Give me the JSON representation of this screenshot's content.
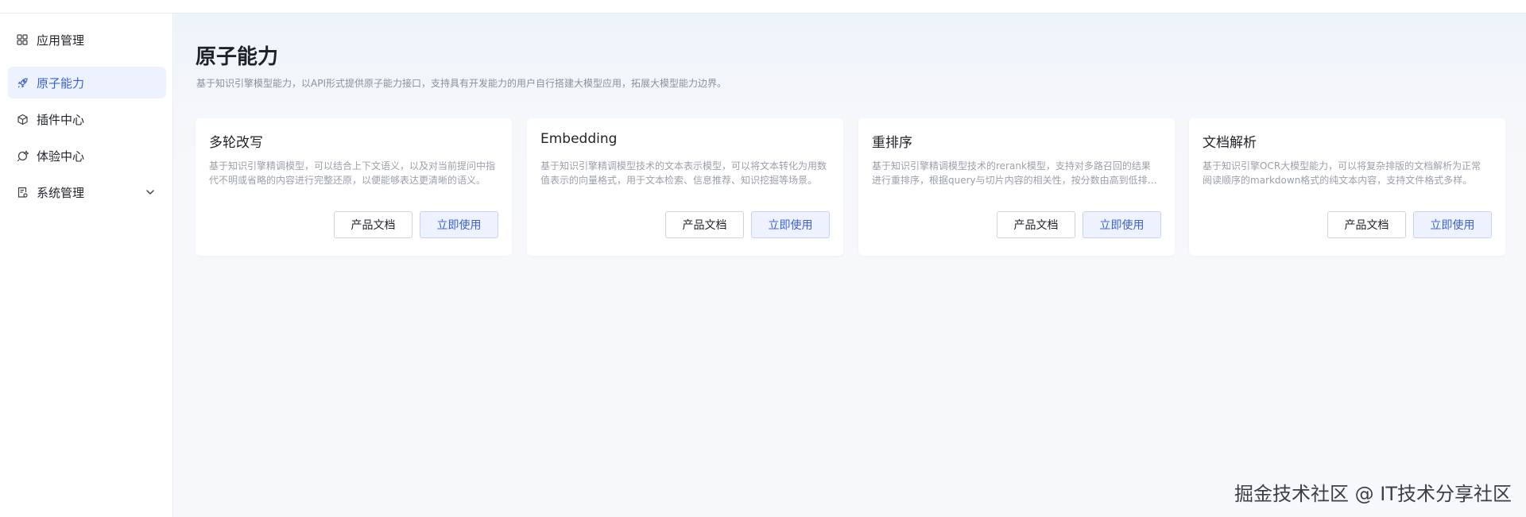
{
  "sidebar": {
    "items": [
      {
        "label": "应用管理",
        "icon": "grid-icon"
      },
      {
        "label": "原子能力",
        "icon": "rocket-icon",
        "active": true
      },
      {
        "label": "插件中心",
        "icon": "cube-icon"
      },
      {
        "label": "体验中心",
        "icon": "chat-icon"
      },
      {
        "label": "系统管理",
        "icon": "settings-doc-icon",
        "expandable": true
      }
    ]
  },
  "main": {
    "title": "原子能力",
    "description": "基于知识引擎模型能力，以API形式提供原子能力接口，支持具有开发能力的用户自行搭建大模型应用，拓展大模型能力边界。",
    "cards": [
      {
        "title": "多轮改写",
        "description": "基于知识引擎精调模型，可以结合上下文语义，以及对当前提问中指代不明或省略的内容进行完整还原，以便能够表达更清晰的语义。",
        "doc_label": "产品文档",
        "use_label": "立即使用"
      },
      {
        "title": "Embedding",
        "description": "基于知识引擎精调模型技术的文本表示模型，可以将文本转化为用数值表示的向量格式，用于文本检索、信息推荐、知识挖掘等场景。",
        "doc_label": "产品文档",
        "use_label": "立即使用"
      },
      {
        "title": "重排序",
        "description": "基于知识引擎精调模型技术的rerank模型，支持对多路召回的结果进行重排序，根据query与切片内容的相关性，按分数由高到低排序。",
        "doc_label": "产品文档",
        "use_label": "立即使用"
      },
      {
        "title": "文档解析",
        "description": "基于知识引擎OCR大模型能力，可以将复杂排版的文档解析为正常阅读顺序的markdown格式的纯文本内容，支持文件格式多样。",
        "doc_label": "产品文档",
        "use_label": "立即使用"
      }
    ]
  },
  "watermark": "掘金技术社区 @ IT技术分享社区",
  "colors": {
    "accent": "#3a62d6",
    "active_bg": "#eef2ff",
    "muted_text": "#9aa0aa"
  }
}
